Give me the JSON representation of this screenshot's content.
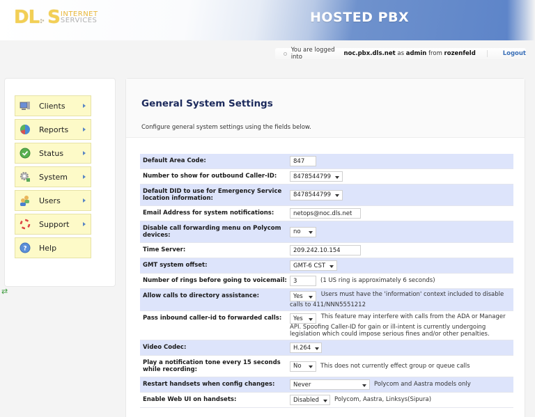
{
  "header": {
    "logo_main": "DLS",
    "logo_line1": "INTERNET",
    "logo_line2": "SERVICES",
    "app_title": "HOSTED PBX"
  },
  "login": {
    "prefix": "You are logged into",
    "host": "noc.pbx.dls.net",
    "as_text": "as",
    "user": "admin",
    "from_text": "from",
    "origin": "rozenfeld",
    "logout_label": "Logout"
  },
  "sidebar": {
    "items": [
      {
        "label": "Clients",
        "icon": "monitor-icon",
        "has_arrow": true
      },
      {
        "label": "Reports",
        "icon": "pie-chart-icon",
        "has_arrow": true
      },
      {
        "label": "Status",
        "icon": "check-circle-icon",
        "has_arrow": true
      },
      {
        "label": "System",
        "icon": "gear-icon",
        "has_arrow": true
      },
      {
        "label": "Users",
        "icon": "users-icon",
        "has_arrow": true
      },
      {
        "label": "Support",
        "icon": "lifebuoy-icon",
        "has_arrow": true
      },
      {
        "label": "Help",
        "icon": "help-icon",
        "has_arrow": false
      }
    ]
  },
  "main": {
    "title": "General System Settings",
    "description": "Configure general system settings using the fields below.",
    "settings": [
      {
        "label": "Default Area Code:",
        "type": "input",
        "value": "847",
        "note": ""
      },
      {
        "label": "Number to show for outbound Caller-ID:",
        "type": "select",
        "value": "8478544799",
        "note": ""
      },
      {
        "label": "Default DID to use for Emergency Service location information:",
        "type": "select",
        "value": "8478544799",
        "note": ""
      },
      {
        "label": "Email Address for system notifications:",
        "type": "input",
        "value": "netops@noc.dls.net",
        "note": ""
      },
      {
        "label": "Disable call forwarding menu on Polycom devices:",
        "type": "select",
        "value": "no",
        "note": ""
      },
      {
        "label": "Time Server:",
        "type": "input",
        "value": "209.242.10.154",
        "note": ""
      },
      {
        "label": "GMT system offset:",
        "type": "select",
        "value": "GMT-6 CST",
        "note": ""
      },
      {
        "label": "Number of rings before going to voicemail:",
        "type": "input",
        "value": "3",
        "note": "(1 US ring is approximately 6 seconds)"
      },
      {
        "label": "Allow calls to directory assistance:",
        "type": "select",
        "value": "Yes",
        "note": "Users must have the 'information' context included to disable calls to 411/NNN5551212"
      },
      {
        "label": "Pass inbound caller-id to forwarded calls:",
        "type": "select",
        "value": "Yes",
        "note": "This feature may interfere with calls from the ADA or Manager API. Spoofing Caller-ID for gain or ill-intent is currently undergoing legislation which could impose serious fines and/or other penalties."
      },
      {
        "label": "Video Codec:",
        "type": "select",
        "value": "H.264",
        "note": ""
      },
      {
        "label": "Play a notification tone every 15 seconds while recording:",
        "type": "select",
        "value": "No",
        "note": "This does not currently effect group or queue calls"
      },
      {
        "label": "Restart handsets when config changes:",
        "type": "select",
        "value": "Never",
        "note": "Polycom and Aastra models only"
      },
      {
        "label": "Enable Web UI on handsets:",
        "type": "select",
        "value": "Disabled",
        "note": "Polycom, Aastra, Linksys(Sipura)"
      }
    ]
  }
}
